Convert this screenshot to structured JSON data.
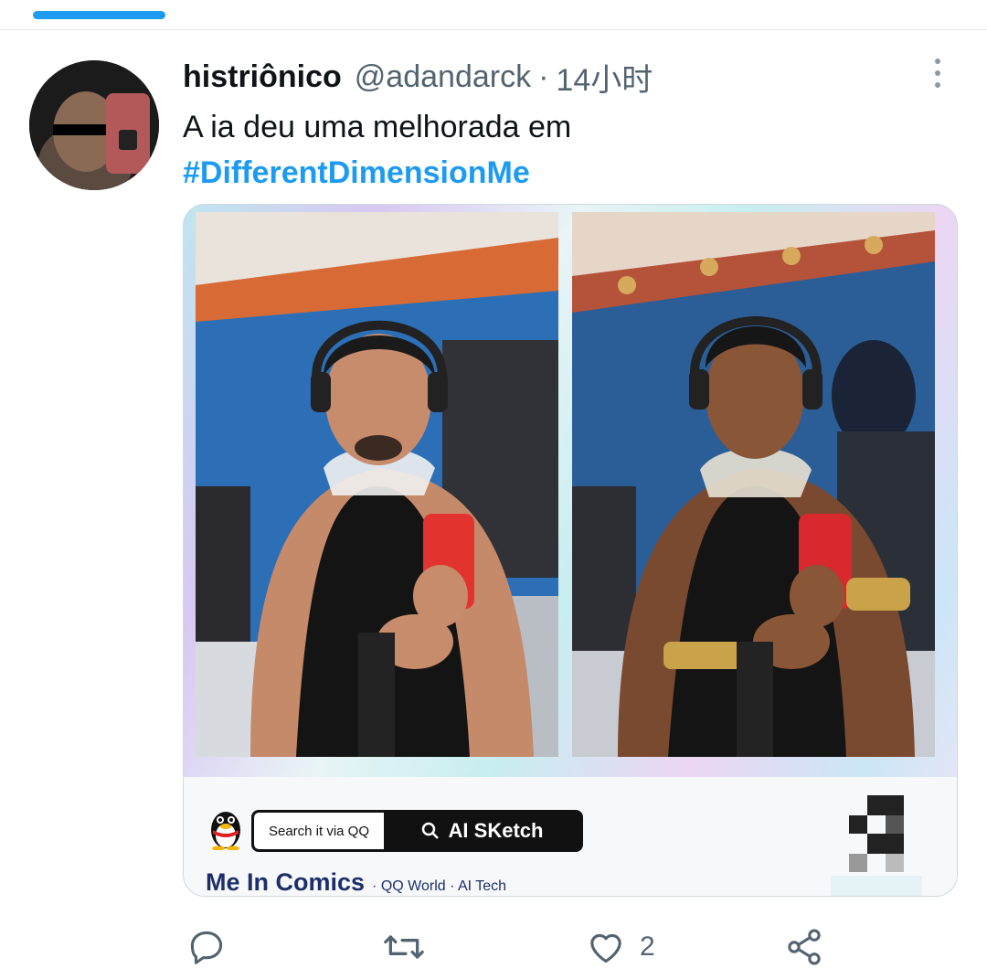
{
  "tweet": {
    "display_name": "histriônico",
    "handle": "@adandarck",
    "separator": "·",
    "timestamp": "14小时",
    "text": "A ia deu uma melhorada em",
    "hashtag": "#DifferentDimensionMe"
  },
  "media_card": {
    "search_label": "Search it via QQ",
    "sketch_label": "AI SKetch",
    "brand_title": "Me In Comics",
    "brand_subtitle": "· QQ World · AI Tech"
  },
  "actions": {
    "like_count": "2"
  },
  "icons": {
    "reply": "reply-icon",
    "retweet": "retweet-icon",
    "like": "heart-icon",
    "share": "share-icon",
    "more": "more-icon"
  },
  "colors": {
    "accent": "#1d9bf0",
    "text": "#0f1419",
    "muted": "#536471",
    "brand": "#1c2f6b"
  }
}
